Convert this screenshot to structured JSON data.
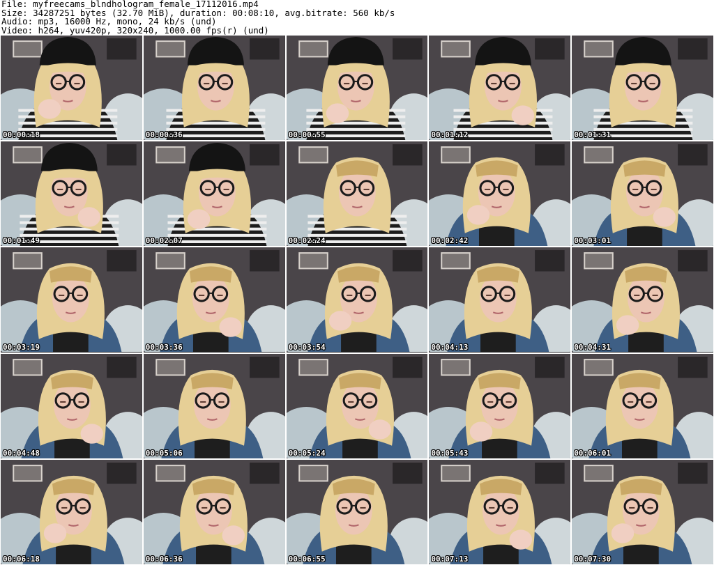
{
  "header": {
    "file_line": "File: myfreecams_blndhologram_female_17112016.mp4",
    "size_line": "Size: 34287251 bytes (32.70 MiB), duration: 00:08:10, avg.bitrate: 560 kb/s",
    "audio_line": "Audio: mp3, 16000 Hz, mono, 24 kb/s (und)",
    "video_line": "Video: h264, yuv420p, 320x240, 1000.00 fps(r) (und)"
  },
  "thumbnails": [
    {
      "timestamp": "00:00:18",
      "hat": true
    },
    {
      "timestamp": "00:00:36",
      "hat": true
    },
    {
      "timestamp": "00:00:55",
      "hat": true
    },
    {
      "timestamp": "00:01:12",
      "hat": true
    },
    {
      "timestamp": "00:01:31",
      "hat": true
    },
    {
      "timestamp": "00:01:49",
      "hat": true
    },
    {
      "timestamp": "00:02:07",
      "hat": true
    },
    {
      "timestamp": "00:02:24",
      "hat": false
    },
    {
      "timestamp": "00:02:42",
      "hat": false
    },
    {
      "timestamp": "00:03:01",
      "hat": false
    },
    {
      "timestamp": "00:03:19",
      "hat": false
    },
    {
      "timestamp": "00:03:36",
      "hat": false
    },
    {
      "timestamp": "00:03:54",
      "hat": false
    },
    {
      "timestamp": "00:04:13",
      "hat": false
    },
    {
      "timestamp": "00:04:31",
      "hat": false
    },
    {
      "timestamp": "00:04:48",
      "hat": false
    },
    {
      "timestamp": "00:05:06",
      "hat": false
    },
    {
      "timestamp": "00:05:24",
      "hat": false
    },
    {
      "timestamp": "00:05:43",
      "hat": false
    },
    {
      "timestamp": "00:06:01",
      "hat": false
    },
    {
      "timestamp": "00:06:18",
      "hat": false
    },
    {
      "timestamp": "00:06:36",
      "hat": false
    },
    {
      "timestamp": "00:06:55",
      "hat": false
    },
    {
      "timestamp": "00:07:13",
      "hat": false
    },
    {
      "timestamp": "00:07:30",
      "hat": false
    }
  ],
  "colors": {
    "background": "#ffffff",
    "hair": "#e6cf96",
    "hat": "#141414",
    "skin": "#ecc6b4",
    "glasses": "#1a1a1a",
    "shirt_stripe": "#eeeeee",
    "denim": "#3e5f85",
    "bedding": "#b9c6cc",
    "wall": "#4a4549"
  }
}
